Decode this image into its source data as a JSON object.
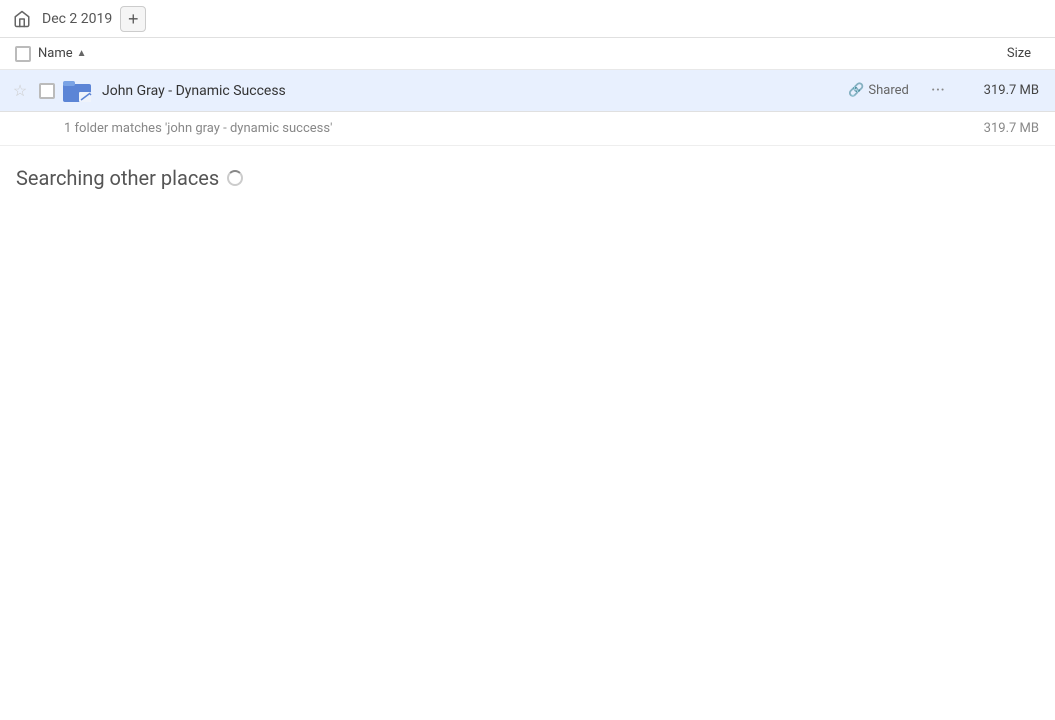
{
  "topbar": {
    "date_label": "Dec 2 2019",
    "add_button_label": "+"
  },
  "columns": {
    "name_label": "Name",
    "size_label": "Size",
    "sort_indicator": "▲"
  },
  "file_row": {
    "name": "John Gray - Dynamic Success",
    "shared_label": "Shared",
    "more_label": "···",
    "size": "319.7 MB"
  },
  "match_summary": {
    "text": "1 folder matches 'john gray - dynamic success'",
    "size": "319.7 MB"
  },
  "searching_section": {
    "title": "Searching other places"
  },
  "icons": {
    "home": "🏠",
    "star_empty": "☆",
    "link": "🔗",
    "sort_asc": "▲"
  }
}
